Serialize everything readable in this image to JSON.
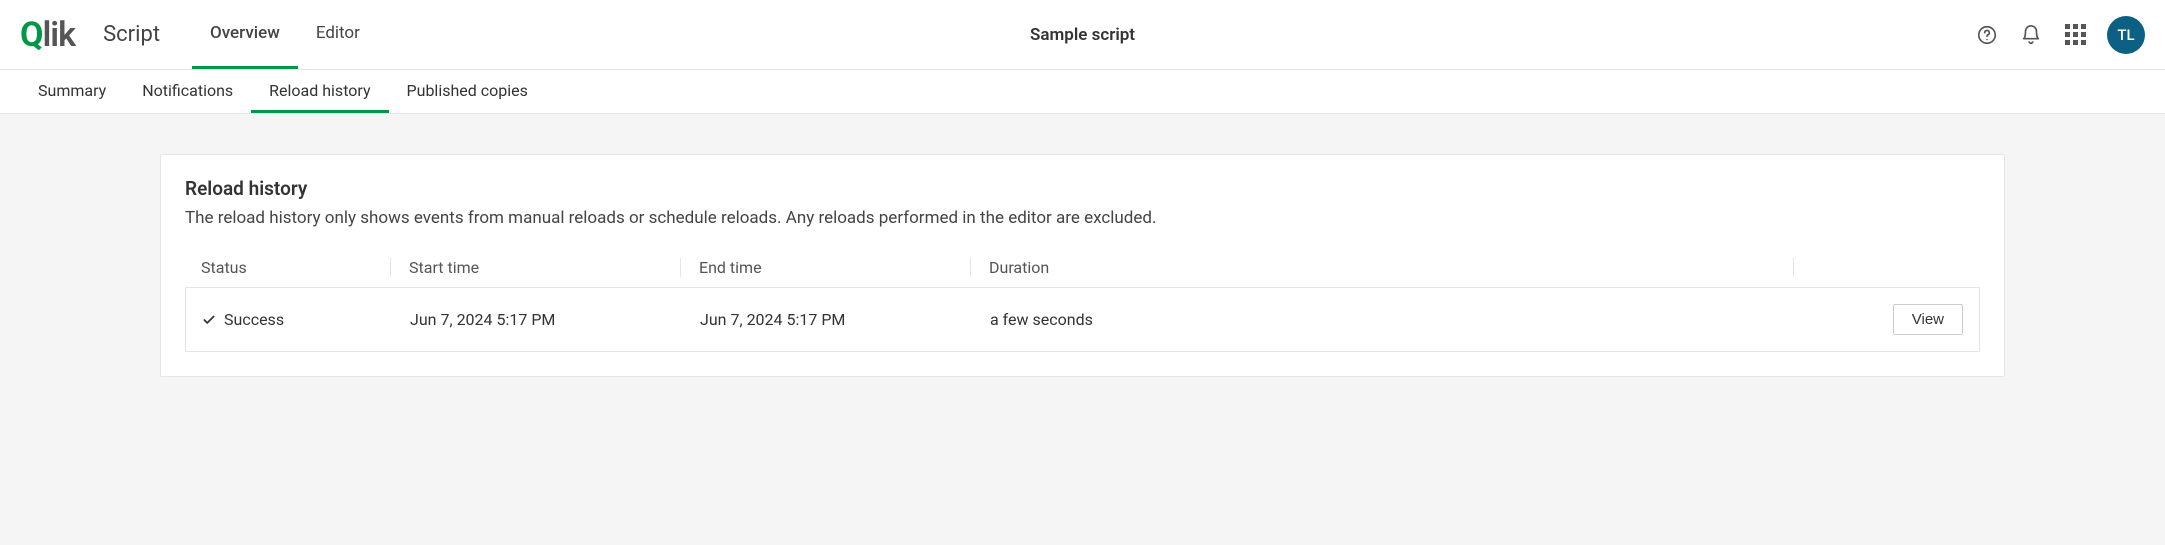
{
  "brand": {
    "logo_q": "Q",
    "logo_rest": "lik"
  },
  "app_type": "Script",
  "title": "Sample script",
  "main_tabs": [
    {
      "label": "Overview",
      "active": true
    },
    {
      "label": "Editor",
      "active": false
    }
  ],
  "sub_tabs": [
    {
      "label": "Summary",
      "active": false
    },
    {
      "label": "Notifications",
      "active": false
    },
    {
      "label": "Reload history",
      "active": true
    },
    {
      "label": "Published copies",
      "active": false
    }
  ],
  "user": {
    "initials": "TL"
  },
  "card": {
    "title": "Reload history",
    "description": "The reload history only shows events from manual reloads or schedule reloads. Any reloads performed in the editor are excluded."
  },
  "table": {
    "headers": {
      "status": "Status",
      "start": "Start time",
      "end": "End time",
      "duration": "Duration"
    },
    "rows": [
      {
        "status": "Success",
        "start": "Jun 7, 2024 5:17 PM",
        "end": "Jun 7, 2024 5:17 PM",
        "duration": "a few seconds",
        "action": "View"
      }
    ]
  }
}
